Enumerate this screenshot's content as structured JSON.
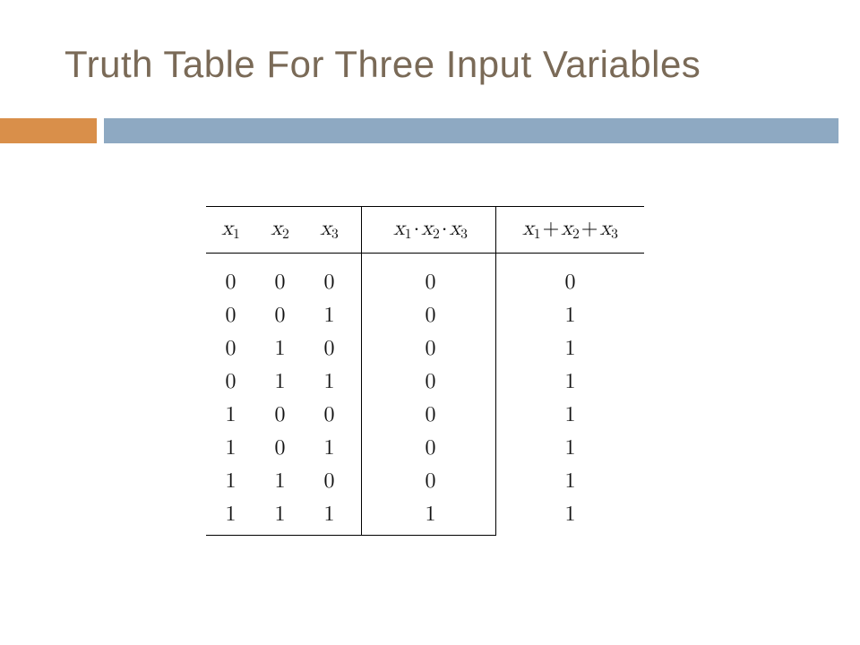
{
  "title": "Truth Table For Three Input Variables",
  "headers": {
    "x1": "x1",
    "x2": "x2",
    "x3": "x3",
    "and": "x1·x2·x3",
    "or": "x1+x2+x3"
  },
  "chart_data": {
    "type": "table",
    "columns": [
      "x1",
      "x2",
      "x3",
      "x1·x2·x3",
      "x1+x2+x3"
    ],
    "rows": [
      {
        "x1": 0,
        "x2": 0,
        "x3": 0,
        "and": 0,
        "or": 0
      },
      {
        "x1": 0,
        "x2": 0,
        "x3": 1,
        "and": 0,
        "or": 1
      },
      {
        "x1": 0,
        "x2": 1,
        "x3": 0,
        "and": 0,
        "or": 1
      },
      {
        "x1": 0,
        "x2": 1,
        "x3": 1,
        "and": 0,
        "or": 1
      },
      {
        "x1": 1,
        "x2": 0,
        "x3": 0,
        "and": 0,
        "or": 1
      },
      {
        "x1": 1,
        "x2": 0,
        "x3": 1,
        "and": 0,
        "or": 1
      },
      {
        "x1": 1,
        "x2": 1,
        "x3": 0,
        "and": 0,
        "or": 1
      },
      {
        "x1": 1,
        "x2": 1,
        "x3": 1,
        "and": 1,
        "or": 1
      }
    ]
  }
}
